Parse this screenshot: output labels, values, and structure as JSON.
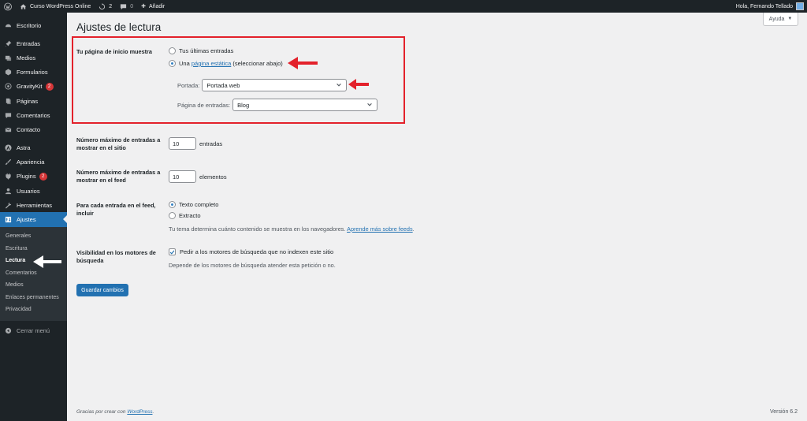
{
  "adminbar": {
    "site_name": "Curso WordPress Online",
    "updates_count": "2",
    "comments_count": "0",
    "new_label": "Añadir",
    "greeting": "Hola, Fernando Tellado"
  },
  "sidebar": {
    "items": [
      {
        "label": "Escritorio",
        "icon": "dashboard-icon"
      },
      {
        "label": "Entradas",
        "icon": "pin-icon"
      },
      {
        "label": "Medios",
        "icon": "media-icon"
      },
      {
        "label": "Formularios",
        "icon": "forms-icon"
      },
      {
        "label": "GravityKit",
        "icon": "gravitykit-icon",
        "badge": "2"
      },
      {
        "label": "Páginas",
        "icon": "pages-icon"
      },
      {
        "label": "Comentarios",
        "icon": "comments-icon"
      },
      {
        "label": "Contacto",
        "icon": "mail-icon"
      },
      {
        "label": "Astra",
        "icon": "astra-icon"
      },
      {
        "label": "Apariencia",
        "icon": "brush-icon"
      },
      {
        "label": "Plugins",
        "icon": "plugin-icon",
        "badge": "2"
      },
      {
        "label": "Usuarios",
        "icon": "users-icon"
      },
      {
        "label": "Herramientas",
        "icon": "tools-icon"
      },
      {
        "label": "Ajustes",
        "icon": "settings-icon"
      }
    ],
    "submenu": [
      "Generales",
      "Escritura",
      "Lectura",
      "Comentarios",
      "Medios",
      "Enlaces permanentes",
      "Privacidad"
    ],
    "collapse_label": "Cerrar menú"
  },
  "help_label": "Ayuda",
  "page_title": "Ajustes de lectura",
  "homepage": {
    "label": "Tu página de inicio muestra",
    "option_latest": "Tus últimas entradas",
    "option_static_prefix": "Una",
    "option_static_link": "página estática",
    "option_static_suffix": "(seleccionar abajo)",
    "front_label": "Portada:",
    "front_value": "Portada web",
    "posts_label": "Página de entradas:",
    "posts_value": "Blog"
  },
  "blog_pages": {
    "label": "Número máximo de entradas a mostrar en el sitio",
    "value": "10",
    "unit": "entradas"
  },
  "feed_items": {
    "label": "Número máximo de entradas a mostrar en el feed",
    "value": "10",
    "unit": "elementos"
  },
  "feed_content": {
    "label": "Para cada entrada en el feed, incluir",
    "option_full": "Texto completo",
    "option_excerpt": "Extracto",
    "description": "Tu tema determina cuánto contenido se muestra en los navegadores.",
    "link": "Aprende más sobre feeds"
  },
  "visibility": {
    "label": "Visibilidad en los motores de búsqueda",
    "checkbox_label": "Pedir a los motores de búsqueda que no indexen este sitio",
    "description": "Depende de los motores de búsqueda atender esta petición o no."
  },
  "save_label": "Guardar cambios",
  "footer": {
    "text": "Gracias por crear con",
    "link": "WordPress",
    "version": "Versión 6.2"
  },
  "colors": {
    "accent": "#2271b1",
    "sidebar": "#1d2327",
    "highlight": "#e3212b"
  }
}
